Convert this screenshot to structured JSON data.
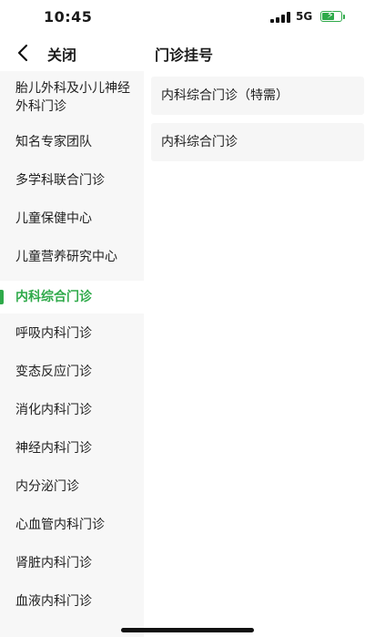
{
  "status_bar": {
    "time": "10:45",
    "network": "5G"
  },
  "nav": {
    "close_label": "关闭",
    "title": "门诊挂号"
  },
  "sidebar": {
    "active_index": 5,
    "items": [
      {
        "label": "胎儿外科及小儿神经外科门诊"
      },
      {
        "label": "知名专家团队"
      },
      {
        "label": "多学科联合门诊"
      },
      {
        "label": "儿童保健中心"
      },
      {
        "label": "儿童营养研究中心"
      },
      {
        "label": "内科综合门诊"
      },
      {
        "label": "呼吸内科门诊"
      },
      {
        "label": "变态反应门诊"
      },
      {
        "label": "消化内科门诊"
      },
      {
        "label": "神经内科门诊"
      },
      {
        "label": "内分泌门诊"
      },
      {
        "label": "心血管内科门诊"
      },
      {
        "label": "肾脏内科门诊"
      },
      {
        "label": "血液内科门诊"
      }
    ]
  },
  "content": {
    "clinics": [
      {
        "label": "内科综合门诊（特需）"
      },
      {
        "label": "内科综合门诊"
      }
    ]
  },
  "colors": {
    "accent": "#2faa4a",
    "sidebar_bg": "#f7f7f7",
    "card_bg": "#f6f6f6"
  }
}
